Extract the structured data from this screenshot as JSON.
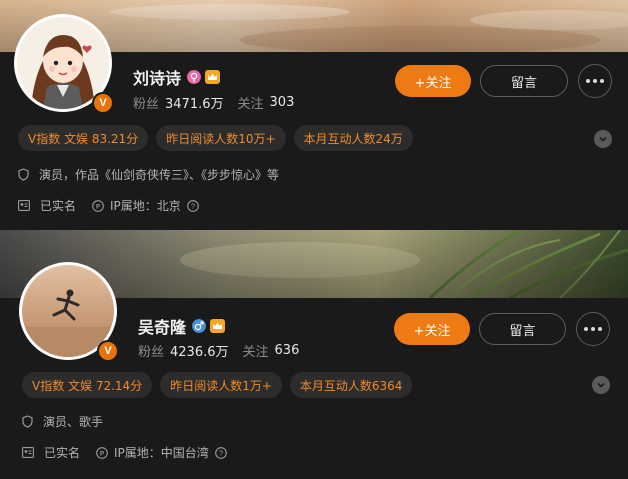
{
  "profiles": [
    {
      "name": "刘诗诗",
      "fans_label": "粉丝",
      "fans_value": "3471.6万",
      "following_label": "关注",
      "following_value": "303",
      "follow_button": "+关注",
      "message_button": "留言",
      "tags": [
        "V指数 文娱 83.21分",
        "昨日阅读人数10万+",
        "本月互动人数24万"
      ],
      "description": "演员，作品《仙剑奇侠传三》、《步步惊心》等",
      "verified_label": "已实名",
      "ip_label": "IP属地：北京"
    },
    {
      "name": "吴奇隆",
      "fans_label": "粉丝",
      "fans_value": "4236.6万",
      "following_label": "关注",
      "following_value": "636",
      "follow_button": "+关注",
      "message_button": "留言",
      "tags": [
        "V指数 文娱 72.14分",
        "昨日阅读人数1万+",
        "本月互动人数6364"
      ],
      "description": "演员、歌手",
      "verified_label": "已实名",
      "ip_label": "IP属地：中国台湾"
    }
  ],
  "badge_letter": "V",
  "colors": {
    "accent": "#ee7a14",
    "tag_text": "#f08a2a",
    "background": "#1a1a1a"
  },
  "icons": [
    "female-gender-icon",
    "male-gender-icon",
    "level-crown-icon",
    "shield-icon",
    "id-card-icon",
    "ip-icon",
    "help-icon",
    "more-dots-icon",
    "chevron-down-icon"
  ]
}
